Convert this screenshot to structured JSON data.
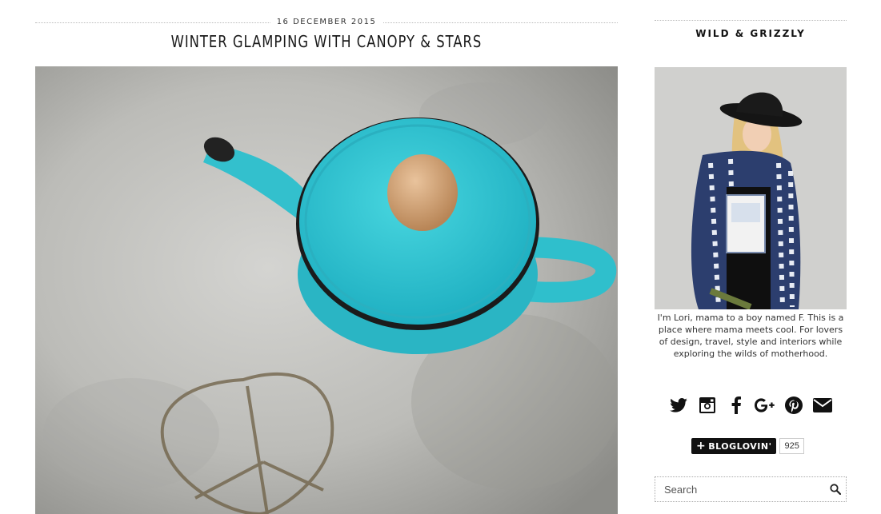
{
  "post": {
    "date": "16 DECEMBER 2015",
    "title": "WINTER GLAMPING WITH CANOPY & STARS"
  },
  "sidebar": {
    "blog_title": "WILD & GRIZZLY",
    "bio": "I'm Lori, mama to a boy named F. This is a place where mama meets cool. For lovers of design, travel, style and interiors while exploring the wilds of motherhood.",
    "social": [
      "twitter-icon",
      "instagram-icon",
      "facebook-icon",
      "google-plus-icon",
      "pinterest-icon",
      "envelope-icon"
    ],
    "bloglovin": {
      "label": "BLOGLOVIN'",
      "count": "925"
    },
    "search": {
      "placeholder": "Search"
    }
  },
  "colors": {
    "teapot": "#37c6d3",
    "concrete": "#b8b8b5",
    "text": "#222222"
  }
}
